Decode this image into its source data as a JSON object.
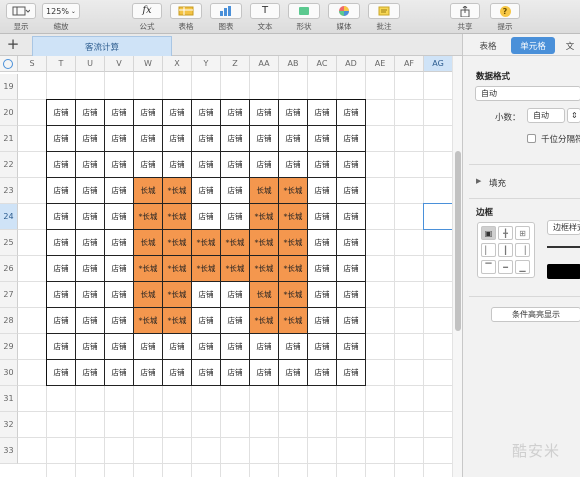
{
  "toolbar": {
    "view_label": "显示",
    "zoom_value": "125%",
    "zoom_label": "缩放",
    "formula_glyph": "fx",
    "formula_label": "公式",
    "table_label": "表格",
    "chart_label": "图表",
    "text_glyph": "T",
    "text_label": "文本",
    "shape_label": "形状",
    "media_label": "媒体",
    "comment_label": "批注",
    "share_label": "共享",
    "tips_glyph": "?",
    "tips_label": "提示"
  },
  "sheet": {
    "add_glyph": "+",
    "tab_name": "客流计算"
  },
  "grid": {
    "columns": [
      "S",
      "T",
      "U",
      "V",
      "W",
      "X",
      "Y",
      "Z",
      "AA",
      "AB",
      "AC",
      "AD",
      "AE",
      "AF",
      "AG"
    ],
    "selected_column": "AG",
    "rows": [
      "19",
      "20",
      "21",
      "22",
      "23",
      "24",
      "25",
      "26",
      "27",
      "28",
      "29",
      "30",
      "31",
      "32",
      "33"
    ],
    "selected_row": "24",
    "table_rows": [
      [
        "店铺",
        "店铺",
        "店铺",
        "店铺",
        "店铺",
        "店铺",
        "店铺",
        "店铺",
        "店铺",
        "店铺",
        "店铺"
      ],
      [
        "店铺",
        "店铺",
        "店铺",
        "店铺",
        "店铺",
        "店铺",
        "店铺",
        "店铺",
        "店铺",
        "店铺",
        "店铺"
      ],
      [
        "店铺",
        "店铺",
        "店铺",
        "店铺",
        "店铺",
        "店铺",
        "店铺",
        "店铺",
        "店铺",
        "店铺",
        "店铺"
      ],
      [
        "店铺",
        "店铺",
        "店铺",
        "长城",
        "*长城",
        "店铺",
        "店铺",
        "长城",
        "*长城",
        "店铺",
        "店铺"
      ],
      [
        "店铺",
        "店铺",
        "店铺",
        "*长城",
        "*长城",
        "店铺",
        "店铺",
        "*长城",
        "*长城",
        "店铺",
        "店铺"
      ],
      [
        "店铺",
        "店铺",
        "店铺",
        "长城",
        "*长城",
        "*长城",
        "*长城",
        "*长城",
        "*长城",
        "店铺",
        "店铺"
      ],
      [
        "店铺",
        "店铺",
        "店铺",
        "*长城",
        "*长城",
        "*长城",
        "*长城",
        "*长城",
        "*长城",
        "店铺",
        "店铺"
      ],
      [
        "店铺",
        "店铺",
        "店铺",
        "长城",
        "*长城",
        "店铺",
        "店铺",
        "长城",
        "*长城",
        "店铺",
        "店铺"
      ],
      [
        "店铺",
        "店铺",
        "店铺",
        "*长城",
        "*长城",
        "店铺",
        "店铺",
        "*长城",
        "*长城",
        "店铺",
        "店铺"
      ],
      [
        "店铺",
        "店铺",
        "店铺",
        "店铺",
        "店铺",
        "店铺",
        "店铺",
        "店铺",
        "店铺",
        "店铺",
        "店铺"
      ],
      [
        "店铺",
        "店铺",
        "店铺",
        "店铺",
        "店铺",
        "店铺",
        "店铺",
        "店铺",
        "店铺",
        "店铺",
        "店铺"
      ]
    ],
    "highlight_value": "长城",
    "highlight_color": "#f4974e"
  },
  "inspector": {
    "tab_table": "表格",
    "tab_cell": "单元格",
    "tab_text_partial": "文",
    "data_format_title": "数据格式",
    "data_format_value": "自动",
    "decimals_label": "小数：",
    "decimals_value": "自动",
    "thousands_label": "千位分隔符",
    "fill_label": "填充",
    "border_title": "边框",
    "border_style_label": "边框样式",
    "conditional_button": "条件高亮显示",
    "accent_color": "#4a90d9"
  },
  "watermark": "酷安米"
}
